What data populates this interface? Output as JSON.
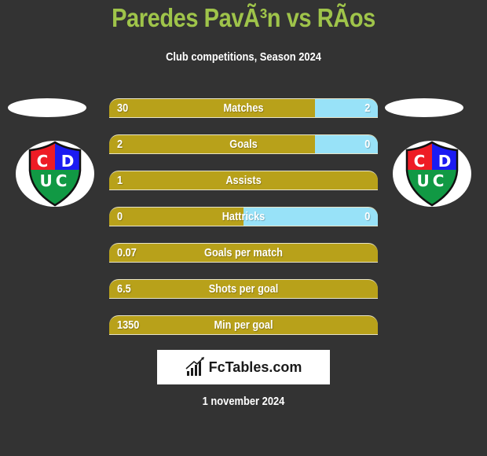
{
  "header": {
    "title": "Paredes PavÃ³n vs RÃos",
    "subtitle": "Club competitions, Season 2024"
  },
  "teams": {
    "left": {
      "logo_text_top": [
        "C",
        "D"
      ],
      "logo_text_bottom": "UC"
    },
    "right": {
      "logo_text_top": [
        "C",
        "D"
      ],
      "logo_text_bottom": "UC"
    }
  },
  "colors": {
    "title": "#9fc44a",
    "left_bar": "#b8a11a",
    "right_bar": "#98e2f8",
    "background": "#333333",
    "logo_red": "#ee1c25",
    "logo_blue": "#1b1bf2",
    "logo_green": "#119944"
  },
  "stats": [
    {
      "label": "Matches",
      "left": "30",
      "right": "2",
      "right_share": 0.235
    },
    {
      "label": "Goals",
      "left": "2",
      "right": "0",
      "right_share": 0.235
    },
    {
      "label": "Assists",
      "left": "1",
      "right": "",
      "right_share": 0
    },
    {
      "label": "Hattricks",
      "left": "0",
      "right": "0",
      "right_share": 0.5
    },
    {
      "label": "Goals per match",
      "left": "0.07",
      "right": "",
      "right_share": 0
    },
    {
      "label": "Shots per goal",
      "left": "6.5",
      "right": "",
      "right_share": 0
    },
    {
      "label": "Min per goal",
      "left": "1350",
      "right": "",
      "right_share": 0
    }
  ],
  "footer": {
    "brand": "FcTables.com",
    "brand_icon": "bar-chart-trend-icon",
    "date": "1 november 2024"
  }
}
